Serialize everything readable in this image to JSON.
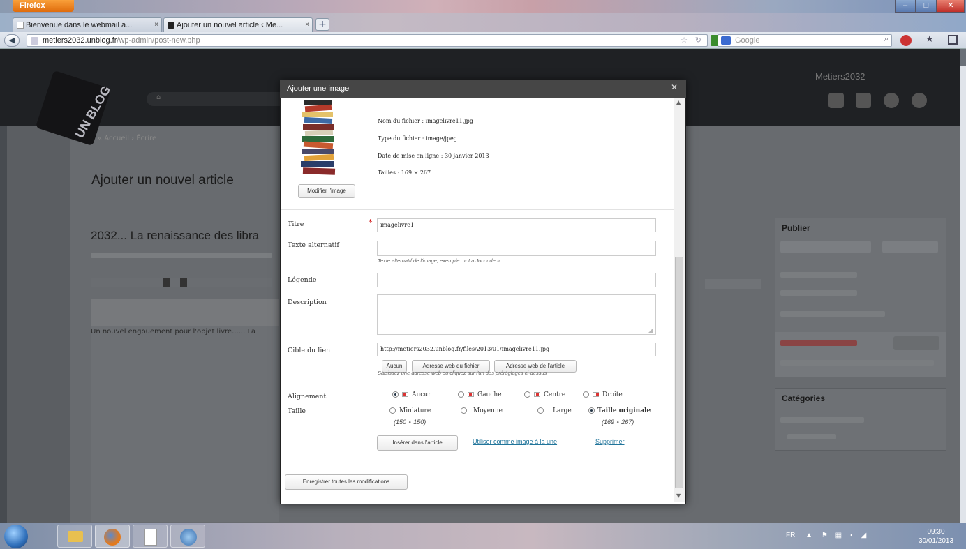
{
  "browser": {
    "firefox_button": "Firefox",
    "tabs": [
      {
        "label": "Bienvenue dans le webmail a..."
      },
      {
        "label": "Ajouter un nouvel article ‹ Me..."
      }
    ],
    "url_domain": "metiers2032.unblog.fr",
    "url_path": "/wp-admin/post-new.php",
    "search_placeholder": "Google"
  },
  "wp": {
    "breadcrumb": "« Accueil › Écrire",
    "page_title": "Ajouter un nouvel article",
    "article_title": "2032... La renaissance des libra",
    "article_text": "Un nouvel engouement pour l'objet livre...... La",
    "site_name": "Metiers2032",
    "sidebar": {
      "publish_title": "Publier",
      "categories_title": "Catégories"
    }
  },
  "dialog": {
    "title": "Ajouter une image",
    "meta": {
      "filename": "Nom du fichier : imagelivre11.jpg",
      "filetype": "Type du fichier : image/jpeg",
      "upload_date": "Date de mise en ligne : 30 janvier 2013",
      "dimensions": "Tailles : 169 × 267"
    },
    "edit_image_button": "Modifier l'image",
    "fields": {
      "title_label": "Titre",
      "title_value": "imagelivre1",
      "title_required": "*",
      "alt_label": "Texte alternatif",
      "alt_help": "Texte alternatif de l'image, exemple : « La Joconde »",
      "caption_label": "Légende",
      "description_label": "Description",
      "link_label": "Cible du lien",
      "link_value": "http://metiers2032.unblog.fr/files/2013/01/imagelivre11.jpg",
      "link_buttons": [
        "Aucun",
        "Adresse web du fichier",
        "Adresse web de l'article"
      ],
      "link_help": "Saisissez une adresse web ou cliquez sur l'un des préréglages ci-dessus",
      "align_label": "Alignement",
      "align_options": [
        "Aucun",
        "Gauche",
        "Centre",
        "Droite"
      ],
      "size_label": "Taille",
      "size_options": [
        {
          "label": "Miniature",
          "dims": "(150 × 150)"
        },
        {
          "label": "Moyenne",
          "dims": ""
        },
        {
          "label": "Large",
          "dims": ""
        },
        {
          "label": "Taille originale",
          "dims": "(169 × 267)"
        }
      ],
      "selected_align": "Aucun",
      "selected_size": "Taille originale"
    },
    "insert_button": "Insérer dans l'article",
    "featured_link": "Utiliser comme image à la une",
    "delete_link": "Supprimer",
    "save_all_button": "Enregistrer toutes les modifications"
  },
  "taskbar": {
    "lang": "FR",
    "time": "09:30",
    "date": "30/01/2013"
  }
}
